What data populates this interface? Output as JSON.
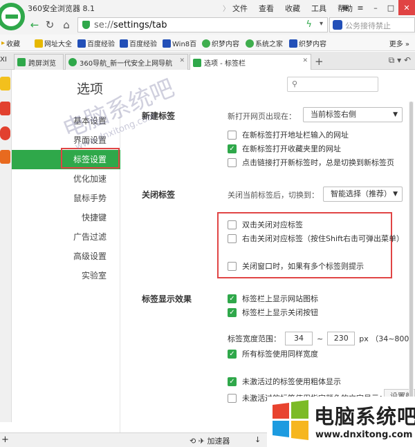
{
  "app": {
    "title": "360安全浏览器 8.1",
    "menu": [
      "文件",
      "查看",
      "收藏",
      "工具",
      "帮助"
    ]
  },
  "address": {
    "url_prefix": "se://",
    "url_path": "settings/tab",
    "search_text": "公务接待禁止",
    "accent": "#2fa84a"
  },
  "bookmarks": {
    "items": [
      "收藏",
      "网址大全",
      "百度经验",
      "百度经验",
      "Win8百",
      "织梦内容",
      "系统之家",
      "织梦内容"
    ],
    "more": "更多"
  },
  "tabs": {
    "items": [
      {
        "label": "跨屏浏览",
        "active": false
      },
      {
        "label": "360导航_新一代安全上网导航",
        "active": false
      },
      {
        "label": "选项 - 标签栏",
        "active": true
      }
    ],
    "partial_left": "XI"
  },
  "options": {
    "title": "选项",
    "nav": [
      "基本设置",
      "界面设置",
      "标签设置",
      "优化加速",
      "鼠标手势",
      "快捷键",
      "广告过滤",
      "高级设置",
      "实验室"
    ],
    "active_nav": "标签设置",
    "new_tab": {
      "section": "新建标签",
      "position_label": "新打开网页出现在：",
      "position_value": "当前标签右侧",
      "options": [
        {
          "label": "在新标签打开地址栏输入的网址",
          "checked": false
        },
        {
          "label": "在新标签打开收藏夹里的网址",
          "checked": true
        },
        {
          "label": "点击链接打开新标签时，总是切换到新标签页",
          "checked": false
        }
      ]
    },
    "close_tab": {
      "section": "关闭标签",
      "switch_label": "关闭当前标签后，切换到：",
      "switch_value": "智能选择（推荐）",
      "options": [
        {
          "label": "双击关闭对应标签",
          "checked": false
        },
        {
          "label": "右击关闭对应标签（按住Shift右击可弹出菜单）",
          "checked": false
        },
        {
          "label": "关闭窗口时，如果有多个标签则提示",
          "checked": false
        }
      ]
    },
    "display": {
      "section": "标签显示效果",
      "options": [
        {
          "label": "标签栏上显示网站图标",
          "checked": true
        },
        {
          "label": "标签栏上显示关闭按钮",
          "checked": true
        }
      ],
      "width_label": "标签宽度范围：",
      "width_min": "34",
      "width_sep": "~",
      "width_max": "230",
      "width_unit": "px （34~800）",
      "same_width": {
        "label": "所有标签使用同样宽度",
        "checked": true
      },
      "bold_inactive": {
        "label": "未激活过的标签使用粗体显示",
        "checked": true
      },
      "color_inactive": {
        "label": "未激活过的标签使用指定颜色的文字显示：",
        "checked": false
      },
      "set_button": "设置颜"
    }
  },
  "statusbar": {
    "accelerator": "加速器"
  },
  "watermark": {
    "faint_title": "电脑系统吧",
    "faint_url": "www.dnxitong.com",
    "title": "电脑系统吧",
    "url": "www.dnxitong.com"
  }
}
